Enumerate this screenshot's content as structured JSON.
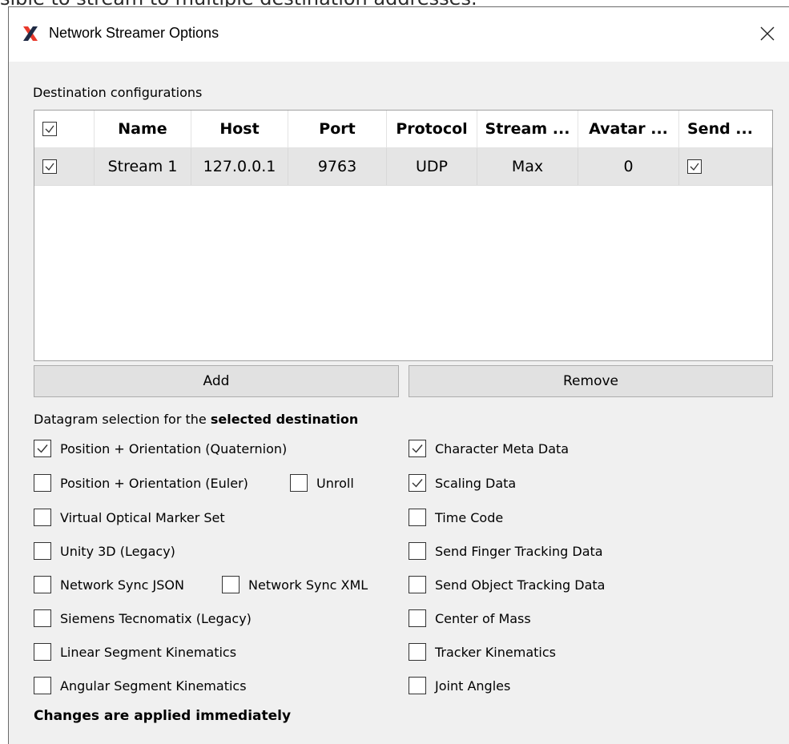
{
  "background_text": "sible to stream to multiple destination addresses.",
  "window": {
    "title": "Network Streamer Options",
    "app_icon": "xsens-x-logo-icon",
    "close_icon": "close-icon"
  },
  "destinations": {
    "label": "Destination configurations",
    "header_checked": true,
    "columns": [
      "Name",
      "Host",
      "Port",
      "Protocol",
      "Stream ...",
      "Avatar ...",
      "Send ..."
    ],
    "rows": [
      {
        "checked": true,
        "name": "Stream 1",
        "host": "127.0.0.1",
        "port": "9763",
        "protocol": "UDP",
        "stream": "Max",
        "avatar": "0",
        "send_checked": true
      }
    ]
  },
  "buttons": {
    "add": "Add",
    "remove": "Remove"
  },
  "datagram": {
    "label_prefix": "Datagram selection for the ",
    "label_bold": "selected destination",
    "options": [
      {
        "id": "pos-quat",
        "label": "Position + Orientation (Quaternion)",
        "checked": true
      },
      {
        "id": "pos-euler",
        "label": "Position + Orientation (Euler)",
        "checked": false
      },
      {
        "id": "unroll",
        "label": "Unroll",
        "checked": false
      },
      {
        "id": "virtual-marker",
        "label": "Virtual Optical Marker Set",
        "checked": false
      },
      {
        "id": "unity3d",
        "label": "Unity 3D (Legacy)",
        "checked": false
      },
      {
        "id": "netsync-json",
        "label": "Network Sync JSON",
        "checked": false
      },
      {
        "id": "netsync-xml",
        "label": "Network Sync XML",
        "checked": false
      },
      {
        "id": "siemens",
        "label": "Siemens Tecnomatix (Legacy)",
        "checked": false
      },
      {
        "id": "linear-kin",
        "label": "Linear Segment Kinematics",
        "checked": false
      },
      {
        "id": "angular-kin",
        "label": "Angular Segment Kinematics",
        "checked": false
      },
      {
        "id": "char-meta",
        "label": "Character Meta Data",
        "checked": true
      },
      {
        "id": "scaling",
        "label": "Scaling Data",
        "checked": true
      },
      {
        "id": "timecode",
        "label": "Time Code",
        "checked": false
      },
      {
        "id": "finger",
        "label": "Send Finger Tracking Data",
        "checked": false
      },
      {
        "id": "object",
        "label": "Send Object Tracking Data",
        "checked": false
      },
      {
        "id": "com",
        "label": "Center of Mass",
        "checked": false
      },
      {
        "id": "tracker-kin",
        "label": "Tracker Kinematics",
        "checked": false
      },
      {
        "id": "joint-angles",
        "label": "Joint Angles",
        "checked": false
      }
    ]
  },
  "footer_note": "Changes are applied immediately",
  "colors": {
    "logo_dark": "#1f2a44",
    "logo_accent": "#e8392b",
    "dialog_bg": "#f0f0f0"
  }
}
